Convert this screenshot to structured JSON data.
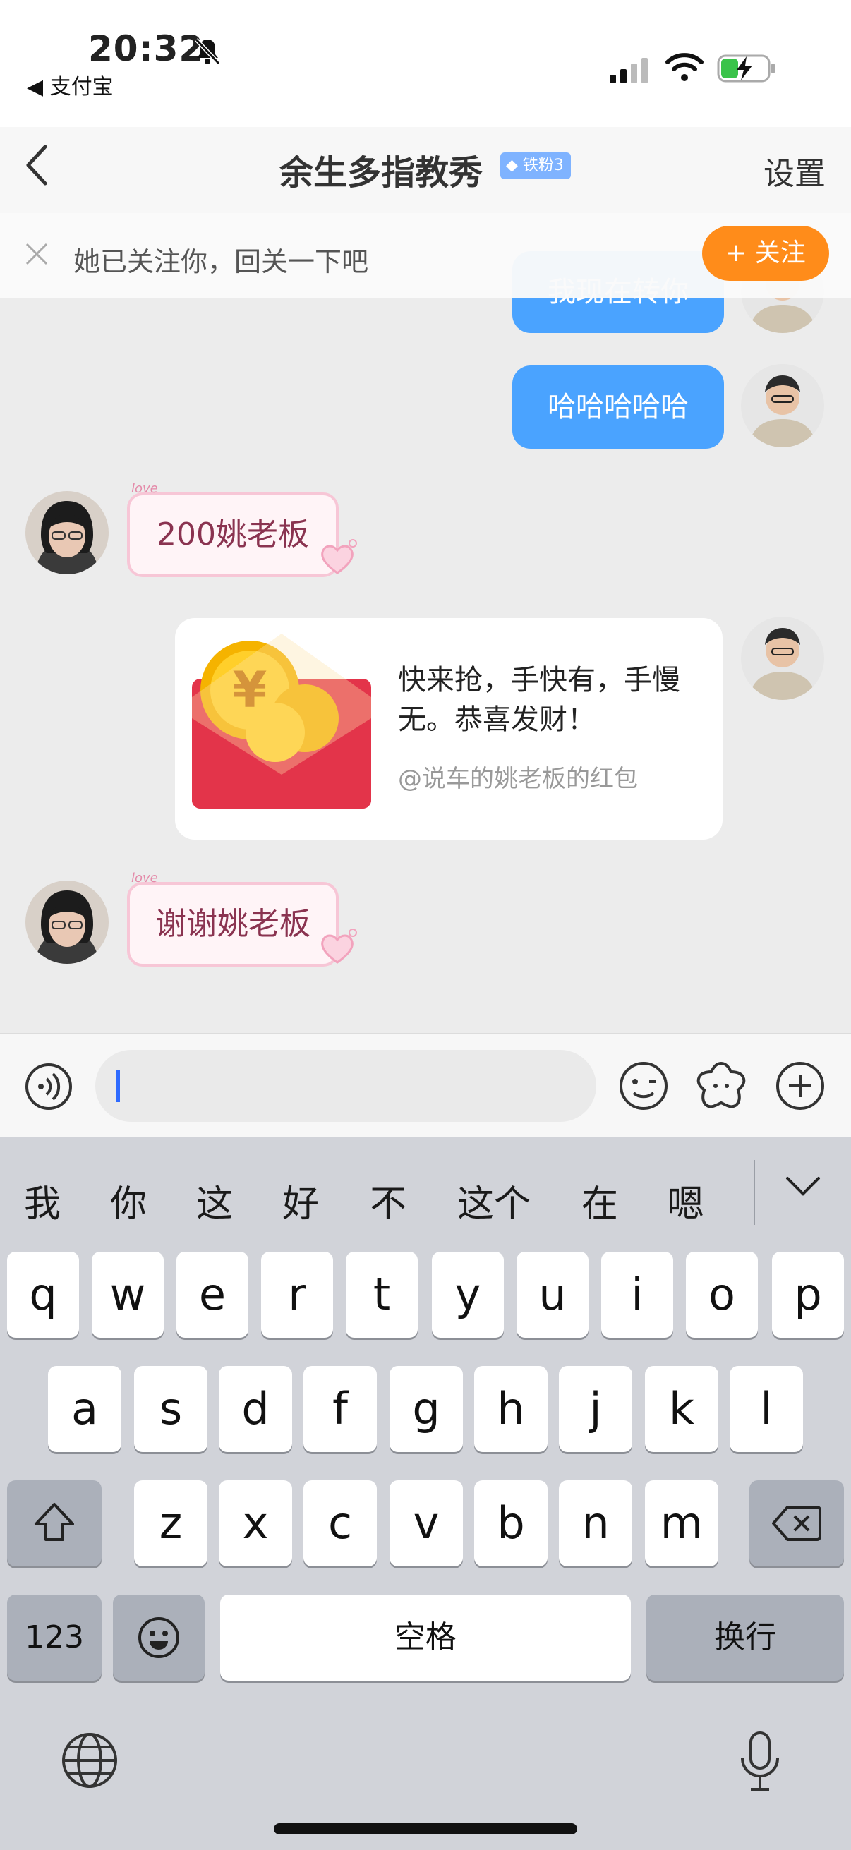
{
  "status_bar": {
    "time": "20:32",
    "back_app": "◀ 支付宝"
  },
  "nav": {
    "title": "余生多指教秀",
    "fan_badge": "铁粉3",
    "settings": "设置"
  },
  "follow_banner": {
    "text": "她已关注你，回关一下吧",
    "button": "+ 关注"
  },
  "messages": [
    {
      "side": "right",
      "type": "text",
      "text": "我现在转你"
    },
    {
      "side": "right",
      "type": "text",
      "text": "哈哈哈哈哈"
    },
    {
      "side": "left",
      "type": "sticker",
      "text": "200姚老板",
      "tag": "love"
    },
    {
      "side": "right",
      "type": "red_packet",
      "text": "快来抢，手快有，手慢无。恭喜发财！",
      "sub": "@说车的姚老板的红包"
    },
    {
      "side": "left",
      "type": "sticker",
      "text": "谢谢姚老板",
      "tag": "love"
    }
  ],
  "candidates": [
    "我",
    "你",
    "这",
    "好",
    "不",
    "这个",
    "在",
    "嗯"
  ],
  "keyboard": {
    "row1": [
      "q",
      "w",
      "e",
      "r",
      "t",
      "y",
      "u",
      "i",
      "o",
      "p"
    ],
    "row2": [
      "a",
      "s",
      "d",
      "f",
      "g",
      "h",
      "j",
      "k",
      "l"
    ],
    "row3": [
      "z",
      "x",
      "c",
      "v",
      "b",
      "n",
      "m"
    ],
    "num_key": "123",
    "space": "空格",
    "return": "换行"
  },
  "colors": {
    "bubble_blue": "#4aa3ff",
    "follow_orange": "#ff8c1a",
    "red_packet": "#e3344a"
  },
  "icons": [
    "mute-icon",
    "signal-icon",
    "wifi-icon",
    "battery-charging-icon",
    "back-chevron-icon",
    "close-icon",
    "voice-icon",
    "emoji-icon",
    "sticker-icon",
    "plus-icon",
    "chevron-down-icon",
    "shift-icon",
    "delete-icon",
    "keyboard-emoji-icon",
    "globe-icon",
    "mic-icon"
  ]
}
